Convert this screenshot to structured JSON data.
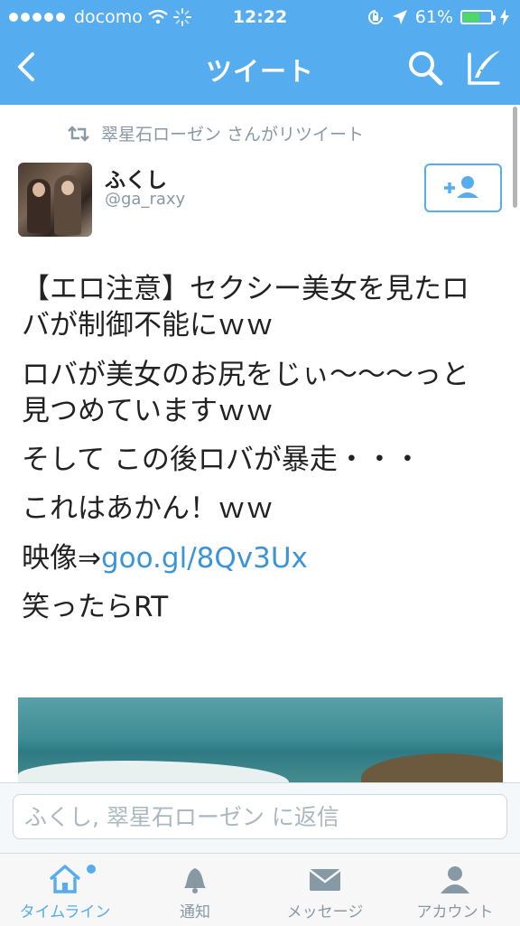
{
  "status_bar": {
    "carrier": "docomo",
    "time": "12:22",
    "battery_percent": "61%",
    "battery_level": 0.61
  },
  "nav": {
    "title": "ツイート"
  },
  "tweet": {
    "retweeted_by": "翠星石ローゼン さんがリツイート",
    "author_name": "ふくし",
    "author_handle": "@ga_raxy",
    "lines": [
      "【エロ注意】セクシー美女を見たロバが制御不能にｗｗ",
      "ロバが美女のお尻をじぃ〜〜〜っと見つめていますｗｗ",
      "そして この後ロバが暴走・・・",
      "これはあかん！ｗｗ"
    ],
    "video_prefix": "映像⇒",
    "link_text": "goo.gl/8Qv3Ux",
    "closing": "笑ったらRT"
  },
  "reply": {
    "placeholder": "ふくし, 翠星石ローゼン に返信"
  },
  "tabs": [
    {
      "label": "タイムライン",
      "icon": "home-icon",
      "active": true
    },
    {
      "label": "通知",
      "icon": "bell-icon",
      "active": false
    },
    {
      "label": "メッセージ",
      "icon": "envelope-icon",
      "active": false
    },
    {
      "label": "アカウント",
      "icon": "person-icon",
      "active": false
    }
  ],
  "colors": {
    "accent": "#55acee",
    "link": "#3b94d9",
    "muted": "#8899a6",
    "battery": "#4cd964"
  }
}
